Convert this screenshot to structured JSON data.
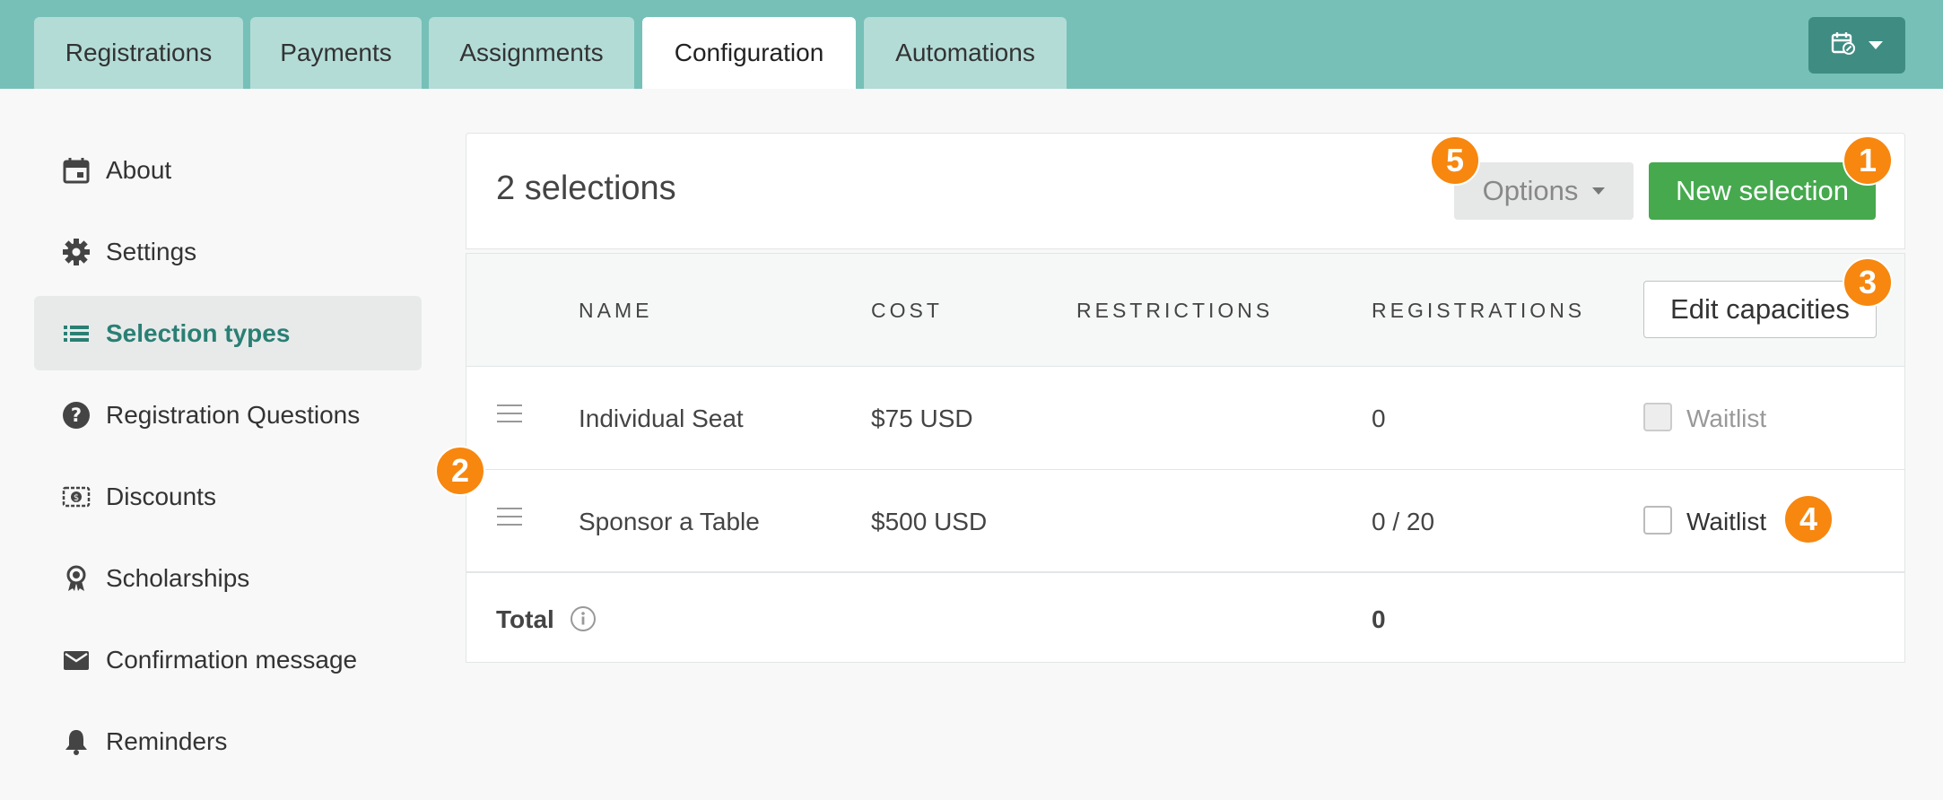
{
  "tabs": [
    {
      "label": "Registrations"
    },
    {
      "label": "Payments"
    },
    {
      "label": "Assignments"
    },
    {
      "label": "Configuration"
    },
    {
      "label": "Automations"
    }
  ],
  "active_tab": "Configuration",
  "sidebar": {
    "items": [
      {
        "label": "About",
        "icon": "calendar-icon"
      },
      {
        "label": "Settings",
        "icon": "gear-icon"
      },
      {
        "label": "Selection types",
        "icon": "list-icon"
      },
      {
        "label": "Registration Questions",
        "icon": "question-icon"
      },
      {
        "label": "Discounts",
        "icon": "discount-icon"
      },
      {
        "label": "Scholarships",
        "icon": "award-icon"
      },
      {
        "label": "Confirmation message",
        "icon": "envelope-icon"
      },
      {
        "label": "Reminders",
        "icon": "bell-icon"
      }
    ],
    "active": "Selection types"
  },
  "header": {
    "title": "2 selections",
    "options_label": "Options",
    "new_label": "New selection"
  },
  "table": {
    "columns": [
      "NAME",
      "COST",
      "RESTRICTIONS",
      "REGISTRATIONS"
    ],
    "edit_label": "Edit capacities",
    "rows": [
      {
        "name": "Individual Seat",
        "cost": "$75 USD",
        "restrictions": "",
        "registrations": "0",
        "waitlist_label": "Waitlist",
        "waitlist_disabled": true
      },
      {
        "name": "Sponsor a Table",
        "cost": "$500 USD",
        "restrictions": "",
        "registrations": "0 / 20",
        "waitlist_label": "Waitlist",
        "waitlist_disabled": false
      }
    ],
    "total_label": "Total",
    "total_value": "0"
  },
  "callouts": [
    "1",
    "2",
    "3",
    "4",
    "5"
  ],
  "colors": {
    "topbar": "#76c0b8",
    "tab_inactive": "#b3dcd7",
    "accent_teal": "#2a7f74",
    "primary_green": "#46a94e",
    "callout_orange": "#f7870f"
  }
}
